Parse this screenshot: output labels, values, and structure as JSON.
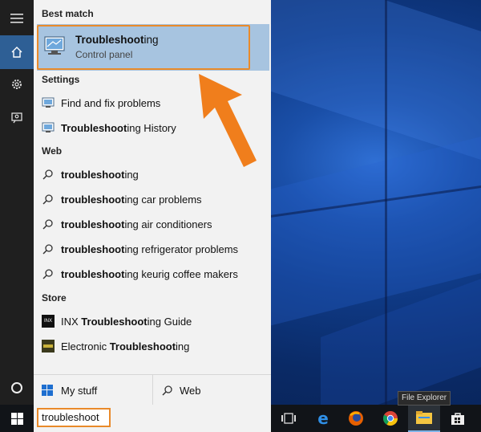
{
  "panel": {
    "best_match_heading": "Best match",
    "best_match": {
      "title_bold": "Troubleshoot",
      "title_rest": "ing",
      "subtitle": "Control panel"
    },
    "settings_heading": "Settings",
    "settings_items": [
      {
        "pre": "",
        "bold": "",
        "rest": "Find and fix problems"
      },
      {
        "pre": "",
        "bold": "Troubleshoot",
        "rest": "ing History"
      }
    ],
    "web_heading": "Web",
    "web_items": [
      {
        "bold": "troubleshoot",
        "rest": "ing"
      },
      {
        "bold": "troubleshoot",
        "rest": "ing car problems"
      },
      {
        "bold": "troubleshoot",
        "rest": "ing air conditioners"
      },
      {
        "bold": "troubleshoot",
        "rest": "ing refrigerator problems"
      },
      {
        "bold": "troubleshoot",
        "rest": "ing keurig coffee makers"
      }
    ],
    "store_heading": "Store",
    "store_items": [
      {
        "pre": "INX ",
        "bold": "Troubleshoot",
        "rest": "ing Guide",
        "icon": "inx-app-icon",
        "icon_text": "INX"
      },
      {
        "pre": "Electronic ",
        "bold": "Troubleshoot",
        "rest": "ing",
        "icon": "electronic-app-icon",
        "icon_text": ""
      }
    ],
    "bottom": {
      "my_stuff": "My stuff",
      "web": "Web"
    }
  },
  "search": {
    "value": "troubleshoot"
  },
  "taskbar": {
    "tooltip": "File Explorer",
    "icons": [
      "task-view-icon",
      "edge-icon",
      "firefox-icon",
      "chrome-icon",
      "file-explorer-icon",
      "store-icon"
    ]
  },
  "colors": {
    "accent_orange": "#e98a2a",
    "highlight": "#a7c4e0",
    "rail": "#1f1f1f",
    "taskbar": "#111418"
  }
}
